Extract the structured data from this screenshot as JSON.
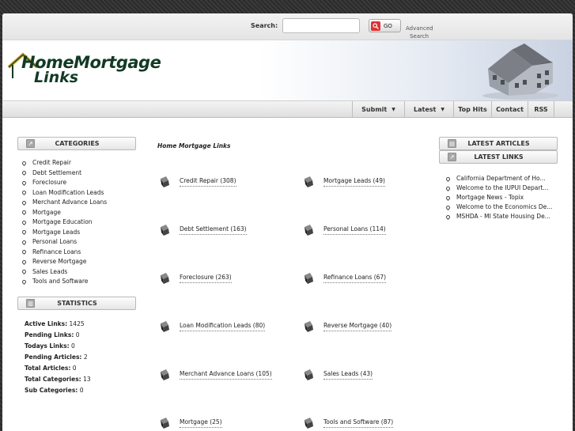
{
  "search": {
    "label": "Search:",
    "placeholder": "",
    "go_label": "GO",
    "advanced_line1": "Advanced",
    "advanced_line2": "Search"
  },
  "logo": {
    "line1": "HomeMortgage",
    "line2": "Links"
  },
  "nav": {
    "items": [
      {
        "label": "Submit",
        "caret": "▼"
      },
      {
        "label": "Latest",
        "caret": "▼"
      },
      {
        "label": "Top Hits"
      },
      {
        "label": "Contact"
      },
      {
        "label": "RSS"
      }
    ]
  },
  "sidebar": {
    "categories_title": "CATEGORIES",
    "categories": [
      "Credit Repair",
      "Debt Settlement",
      "Foreclosure",
      "Loan Modification Leads",
      "Merchant Advance Loans",
      "Mortgage",
      "Mortgage Education",
      "Mortgage Leads",
      "Personal Loans",
      "Refinance Loans",
      "Reverse Mortgage",
      "Sales Leads",
      "Tools and Software"
    ],
    "statistics_title": "STATISTICS",
    "stats": [
      {
        "label": "Active Links:",
        "value": "1425"
      },
      {
        "label": "Pending Links:",
        "value": "0"
      },
      {
        "label": "Todays Links:",
        "value": "0"
      },
      {
        "label": "Pending Articles:",
        "value": "2"
      },
      {
        "label": "Total Articles:",
        "value": "0"
      },
      {
        "label": "Total Categories:",
        "value": "13"
      },
      {
        "label": "Sub Categories:",
        "value": "0"
      }
    ]
  },
  "main": {
    "title": "Home Mortgage Links",
    "links": [
      "Credit Repair (308)",
      "Mortgage Leads (49)",
      "Debt Settlement (163)",
      "Personal Loans (114)",
      "Foreclosure (263)",
      "Refinance Loans (67)",
      "Loan Modification Leads (80)",
      "Reverse Mortgage (40)",
      "Merchant Advance Loans (105)",
      "Sales Leads (43)",
      "Mortgage (25)",
      "Tools and Software (87)"
    ]
  },
  "right": {
    "articles_title": "LATEST ARTICLES",
    "links_title": "LATEST LINKS",
    "latest_links": [
      "California Department of Ho...",
      "Welcome to the IUPUI Depart...",
      "Mortgage News - Topix",
      "Welcome to the Economics De...",
      "MSHDA - MI State Housing De..."
    ]
  }
}
